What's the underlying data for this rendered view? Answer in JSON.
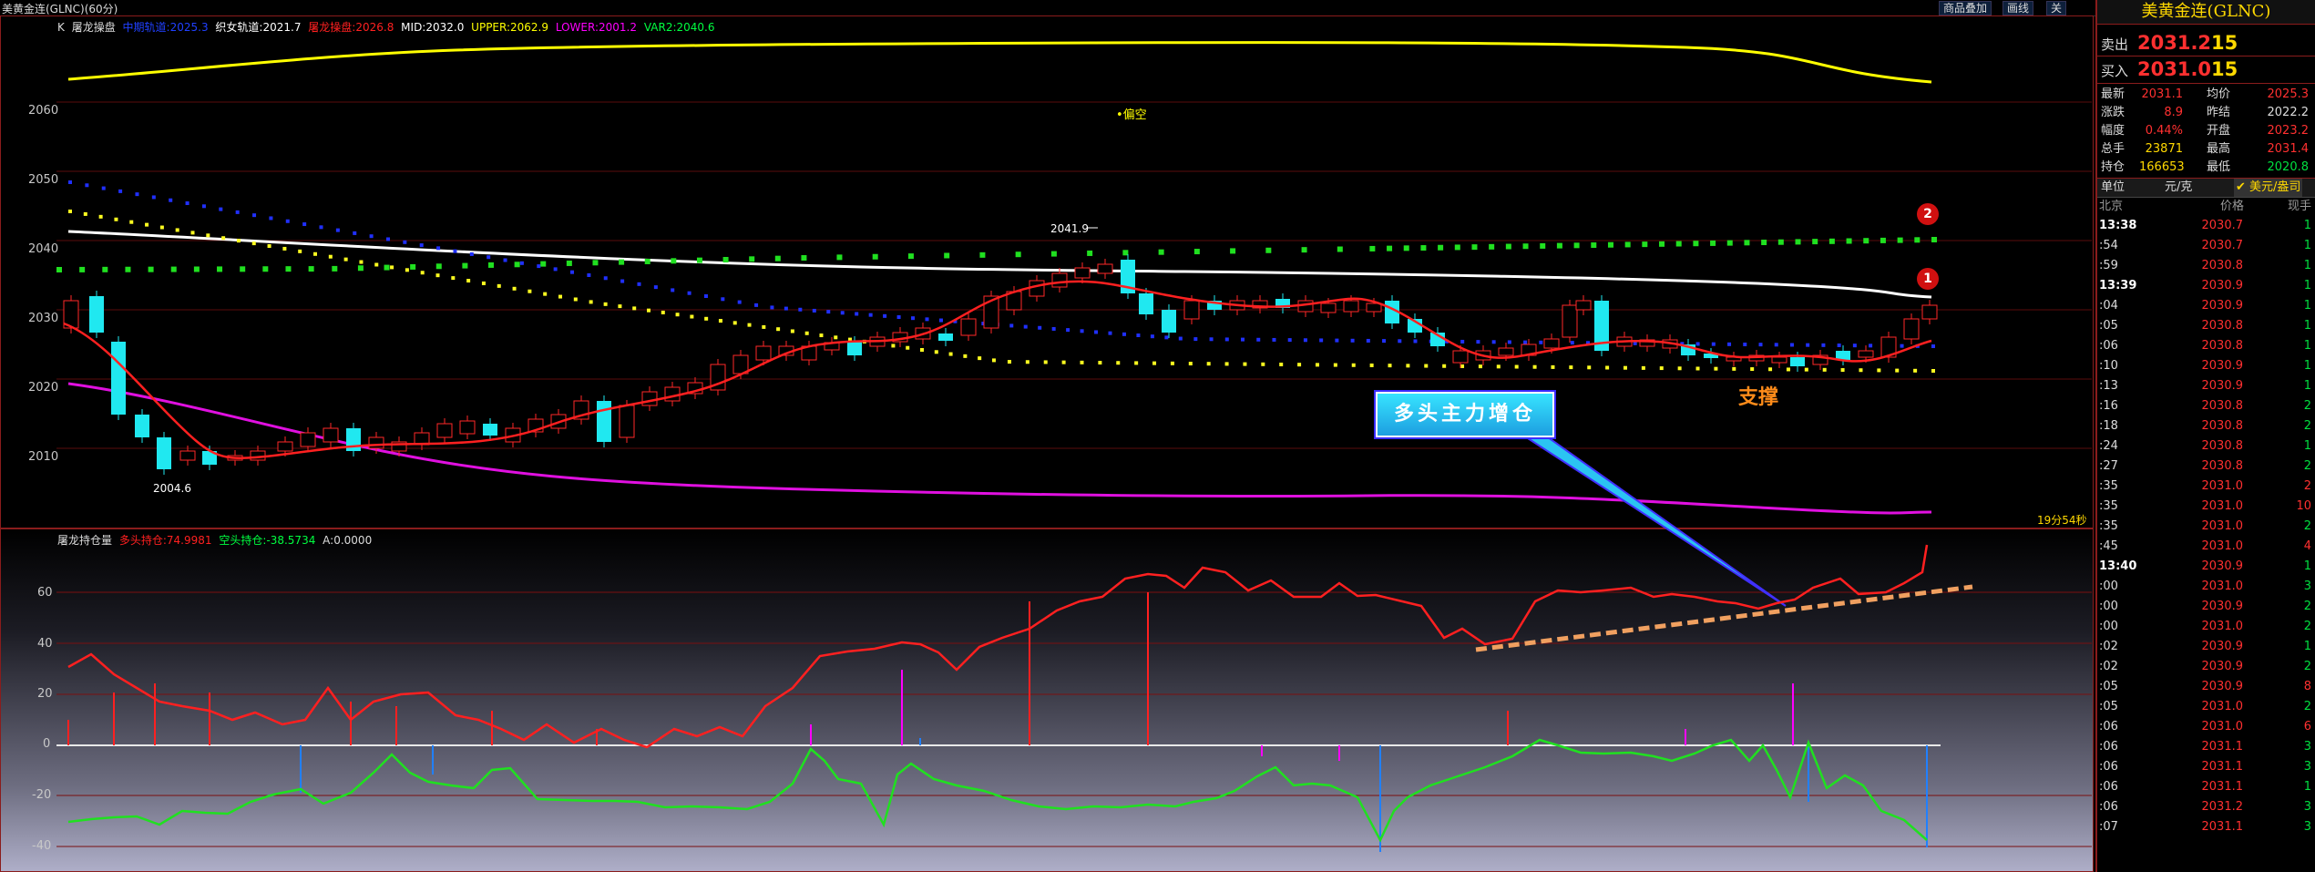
{
  "window": {
    "title": "美黄金连(GLNC)(60分)",
    "buttons": [
      "商品叠加",
      "画线",
      "关"
    ]
  },
  "main_chart": {
    "legend_prefix": "K",
    "legend": [
      {
        "label": "屠龙操盘",
        "color": "#dcdcdc"
      },
      {
        "label": "中期轨道:2025.3",
        "color": "#2040ff"
      },
      {
        "label": "织女轨道:2021.7",
        "color": "#ffffff"
      },
      {
        "label": "屠龙操盘:2026.8",
        "color": "#ff2020"
      },
      {
        "label": "MID:2032.0",
        "color": "#ffffff"
      },
      {
        "label": "UPPER:2062.9",
        "color": "#ffff00"
      },
      {
        "label": "LOWER:2001.2",
        "color": "#ff00ff"
      },
      {
        "label": "VAR2:2040.6",
        "color": "#00ff40"
      }
    ],
    "y_ticks": [
      "2060",
      "2050",
      "2040",
      "2030",
      "2020",
      "2010"
    ],
    "annotations": {
      "high_label": "2041.9",
      "low_label": "2004.6",
      "signal_text": "•偏空",
      "support_text": "支撑",
      "callout_text": "多头主力增仓",
      "badge_1": "1",
      "badge_2": "2",
      "countdown": "19分54秒"
    }
  },
  "sub_chart": {
    "legend": [
      {
        "label": "屠龙持仓量",
        "color": "#dcdcdc"
      },
      {
        "label": "多头持仓:74.9981",
        "color": "#ff2020"
      },
      {
        "label": "空头持仓:-38.5734",
        "color": "#00ff40"
      },
      {
        "label": "A:0.0000",
        "color": "#dcdcdc"
      }
    ],
    "y_ticks": [
      "60",
      "40",
      "20",
      "0",
      "-20",
      "-40"
    ]
  },
  "quote": {
    "title": "美黄金连(GLNC)",
    "sell": {
      "label": "卖出",
      "price": "2031.2",
      "vol": "15"
    },
    "buy": {
      "label": "买入",
      "price": "2031.0",
      "vol": "15"
    },
    "stats": [
      {
        "l1": "最新",
        "v1": "2031.1",
        "c1": "#ff3030",
        "l2": "均价",
        "v2": "2025.3",
        "c2": "#ff3030"
      },
      {
        "l1": "涨跌",
        "v1": "8.9",
        "c1": "#ff3030",
        "l2": "昨结",
        "v2": "2022.2",
        "c2": "#dcdcdc"
      },
      {
        "l1": "幅度",
        "v1": "0.44%",
        "c1": "#ff3030",
        "l2": "开盘",
        "v2": "2023.2",
        "c2": "#ff3030"
      },
      {
        "l1": "总手",
        "v1": "23871",
        "c1": "#ffd800",
        "l2": "最高",
        "v2": "2031.4",
        "c2": "#ff3030"
      },
      {
        "l1": "持仓",
        "v1": "166653",
        "c1": "#ffd800",
        "l2": "最低",
        "v2": "2020.8",
        "c2": "#00e040"
      }
    ],
    "unit_label": "单位",
    "unit_value": "元/克",
    "unit_alt": "✔ 美元/盎司",
    "tick_headers": [
      "北京",
      "价格",
      "现手"
    ],
    "ticks": [
      {
        "t": "13:38",
        "p": "2030.7",
        "v": "1",
        "vc": "#00e040",
        "tb": true
      },
      {
        "t": ":54",
        "p": "2030.7",
        "v": "1",
        "vc": "#00e040"
      },
      {
        "t": ":59",
        "p": "2030.8",
        "v": "1",
        "vc": "#00e040"
      },
      {
        "t": "13:39",
        "p": "2030.9",
        "v": "1",
        "vc": "#00e040",
        "tb": true
      },
      {
        "t": ":04",
        "p": "2030.9",
        "v": "1",
        "vc": "#00e040"
      },
      {
        "t": ":05",
        "p": "2030.8",
        "v": "1",
        "vc": "#00e040"
      },
      {
        "t": ":06",
        "p": "2030.8",
        "v": "1",
        "vc": "#00e040"
      },
      {
        "t": ":10",
        "p": "2030.9",
        "v": "1",
        "vc": "#00e040"
      },
      {
        "t": ":13",
        "p": "2030.9",
        "v": "1",
        "vc": "#00e040"
      },
      {
        "t": ":16",
        "p": "2030.8",
        "v": "2",
        "vc": "#00e040"
      },
      {
        "t": ":18",
        "p": "2030.8",
        "v": "2",
        "vc": "#00e040"
      },
      {
        "t": ":24",
        "p": "2030.8",
        "v": "1",
        "vc": "#00e040"
      },
      {
        "t": ":27",
        "p": "2030.8",
        "v": "2",
        "vc": "#00e040"
      },
      {
        "t": ":35",
        "p": "2031.0",
        "v": "2",
        "vc": "#ff3030"
      },
      {
        "t": ":35",
        "p": "2031.0",
        "v": "10",
        "vc": "#ff3030"
      },
      {
        "t": ":35",
        "p": "2031.0",
        "v": "2",
        "vc": "#00e040"
      },
      {
        "t": ":45",
        "p": "2031.0",
        "v": "4",
        "vc": "#ff3030"
      },
      {
        "t": "13:40",
        "p": "2030.9",
        "v": "1",
        "vc": "#00e040",
        "tb": true
      },
      {
        "t": ":00",
        "p": "2031.0",
        "v": "3",
        "vc": "#00e040"
      },
      {
        "t": ":00",
        "p": "2030.9",
        "v": "2",
        "vc": "#00e040"
      },
      {
        "t": ":00",
        "p": "2031.0",
        "v": "2",
        "vc": "#00e040"
      },
      {
        "t": ":02",
        "p": "2030.9",
        "v": "1",
        "vc": "#00e040"
      },
      {
        "t": ":02",
        "p": "2030.9",
        "v": "2",
        "vc": "#00e040"
      },
      {
        "t": ":05",
        "p": "2030.9",
        "v": "8",
        "vc": "#ff3030"
      },
      {
        "t": ":05",
        "p": "2031.0",
        "v": "2",
        "vc": "#00e040"
      },
      {
        "t": ":06",
        "p": "2031.0",
        "v": "6",
        "vc": "#ff3030"
      },
      {
        "t": ":06",
        "p": "2031.1",
        "v": "3",
        "vc": "#00e040"
      },
      {
        "t": ":06",
        "p": "2031.1",
        "v": "3",
        "vc": "#00e040"
      },
      {
        "t": ":06",
        "p": "2031.1",
        "v": "1",
        "vc": "#00e040"
      },
      {
        "t": ":06",
        "p": "2031.2",
        "v": "3",
        "vc": "#00e040"
      },
      {
        "t": ":07",
        "p": "2031.1",
        "v": "3",
        "vc": "#00e040"
      }
    ]
  },
  "chart_data": {
    "type": "line",
    "y_range": [
      2000,
      2068
    ],
    "series": [
      {
        "name": "UPPER",
        "color": "#ffff00",
        "values": [
          2063,
          2064,
          2066,
          2067,
          2068,
          2068,
          2068,
          2067,
          2066,
          2064,
          2063
        ]
      },
      {
        "name": "MID",
        "color": "#ffffff",
        "values": [
          2041.5,
          2040,
          2038,
          2037,
          2036,
          2035.5,
          2035,
          2034.5,
          2034,
          2033,
          2032
        ]
      },
      {
        "name": "LOWER",
        "color": "#ff00ff",
        "values": [
          2019.5,
          2015,
          2011,
          2008,
          2006,
          2005,
          2005,
          2004.5,
          2003.5,
          2002,
          2001.2
        ]
      },
      {
        "name": "屠龙操盘",
        "color": "#ff2020",
        "values": [
          2028,
          2009,
          2013,
          2024,
          2027,
          2034,
          2030,
          2026,
          2023,
          2024,
          2026.8
        ]
      },
      {
        "name": "多头持仓",
        "color": "#ff2020",
        "values": [
          32,
          15,
          8,
          38,
          40,
          65,
          60,
          45,
          62,
          60,
          75
        ]
      },
      {
        "name": "空头持仓",
        "color": "#00ff40",
        "values": [
          -30,
          -22,
          -20,
          -28,
          -2,
          -25,
          -10,
          -5,
          0,
          -10,
          -38.6
        ]
      }
    ]
  }
}
